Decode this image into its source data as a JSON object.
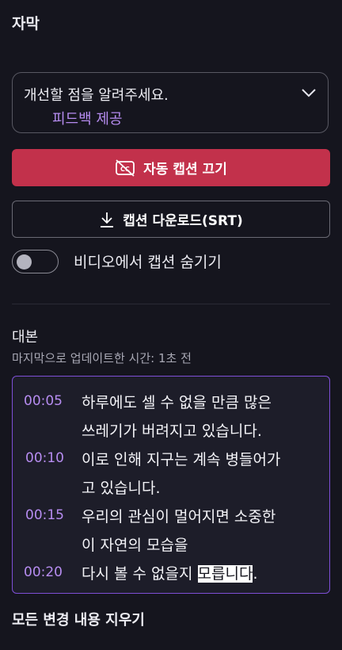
{
  "header": {
    "title": "자막"
  },
  "feedback": {
    "prompt": "개선할 점을 알려주세요.",
    "link": "피드백 제공"
  },
  "buttons": {
    "auto_caption_off": "자동 캡션 끄기",
    "download_captions": "캡션 다운로드(SRT)"
  },
  "toggle": {
    "label": "비디오에서 캡션 숨기기",
    "on": false
  },
  "transcript": {
    "title": "대본",
    "last_updated": "마지막으로 업데이트한 시간: 1초 전",
    "entries": [
      {
        "time": "00:05",
        "line1": "하루에도 셀 수 없을 만큼 많은",
        "line2": "쓰레기가 버려지고 있습니다."
      },
      {
        "time": "00:10",
        "line1": "이로 인해 지구는 계속 병들어가",
        "line2": "고 있습니다."
      },
      {
        "time": "00:15",
        "line1": "우리의 관심이 멀어지면 소중한",
        "line2": "이 자연의 모습을"
      },
      {
        "time": "00:20",
        "line1_pre": "다시 볼 수 없을지 ",
        "line1_hl": "모릅니다",
        "line1_post": "."
      }
    ]
  },
  "footer": {
    "clear_all": "모든 변경 내용 지우기"
  },
  "colors": {
    "accent": "#b68cf0",
    "danger": "#c2314b",
    "border_focus": "#7e4fd6",
    "background": "#15151e"
  }
}
